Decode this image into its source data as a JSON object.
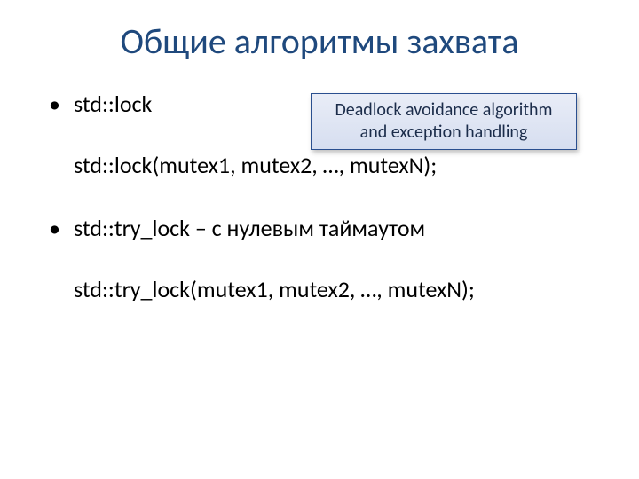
{
  "title": "Общие алгоритмы захвата",
  "callout": "Deadlock avoidance algorithm and exception handling",
  "items": [
    {
      "bullet": "std::lock",
      "code": "std::lock(mutex1, mutex2, …, mutexN);"
    },
    {
      "bullet": "std::try_lock – с нулевым таймаутом",
      "code": "std::try_lock(mutex1, mutex2, …, mutexN);"
    }
  ]
}
